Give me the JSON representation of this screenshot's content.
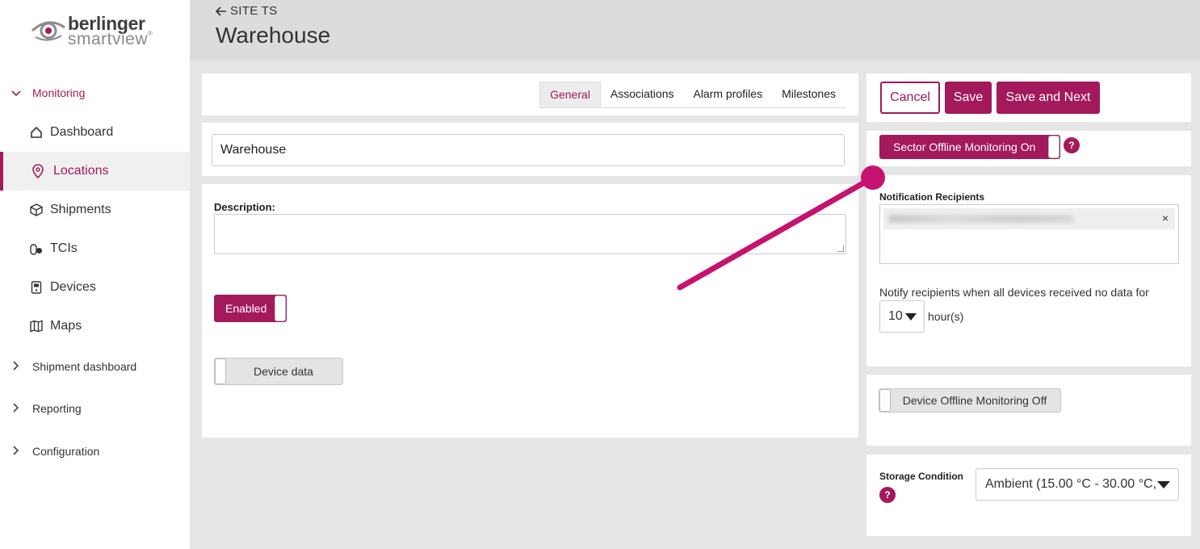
{
  "brand": {
    "name_top": "berlinger",
    "name_bottom": "smartview",
    "registered": "®"
  },
  "sidebar": {
    "monitoring": "Monitoring",
    "items": [
      {
        "label": "Dashboard",
        "icon": "home-icon"
      },
      {
        "label": "Locations",
        "icon": "location-pin-icon"
      },
      {
        "label": "Shipments",
        "icon": "box-icon"
      },
      {
        "label": "TCIs",
        "icon": "pills-icon"
      },
      {
        "label": "Devices",
        "icon": "device-icon"
      },
      {
        "label": "Maps",
        "icon": "map-icon"
      }
    ],
    "shipment_dashboard": "Shipment dashboard",
    "reporting": "Reporting",
    "configuration": "Configuration"
  },
  "header": {
    "back_label": "SITE TS",
    "title": "Warehouse"
  },
  "tabs": [
    "General",
    "Associations",
    "Alarm profiles",
    "Milestones"
  ],
  "form": {
    "name_value": "Warehouse",
    "description_label": "Description:",
    "description_value": "",
    "enabled_label": "Enabled",
    "device_data_label": "Device data"
  },
  "actions": {
    "cancel": "Cancel",
    "save": "Save",
    "save_next": "Save and Next"
  },
  "sector": {
    "toggle_label": "Sector Offline Monitoring On",
    "help": "?",
    "recipients_label": "Notification Recipients",
    "remove": "×",
    "notify_text": "Notify recipients when all devices received no data for",
    "hours_value": "10",
    "hours_unit": "hour(s)"
  },
  "device_offline": {
    "toggle_label": "Device Offline Monitoring Off"
  },
  "storage": {
    "label": "Storage Condition",
    "help": "?",
    "value": "Ambient (15.00 °C - 30.00 °C,"
  },
  "colors": {
    "accent": "#a3195b",
    "header_bg": "#dcdcdc",
    "page_bg": "#e6e6e6"
  }
}
